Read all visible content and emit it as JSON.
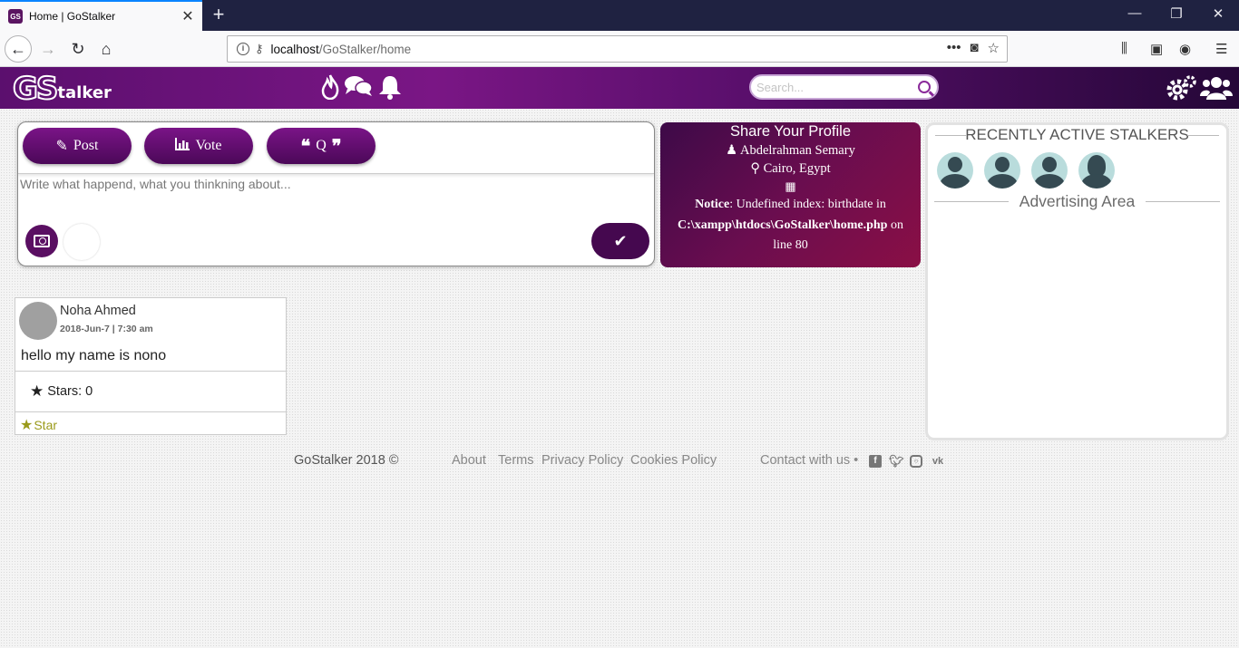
{
  "browser": {
    "tab_title": "Home | GoStalker",
    "favicon_text": "GS",
    "url_host": "localhost",
    "url_path": "/GoStalker/home"
  },
  "header": {
    "logo_gs": "GS",
    "logo_rest": "talker",
    "search_placeholder": "Search..."
  },
  "composer": {
    "buttons": [
      {
        "label": "Post",
        "icon": "edit-icon"
      },
      {
        "label": "Vote",
        "icon": "chart-icon"
      },
      {
        "label": "Q",
        "icon": "quote-icon"
      }
    ],
    "placeholder": "Write what happend, what you thinkning about..."
  },
  "profile_card": {
    "title": "Share Your Profile",
    "name": "Abdelrahman Semary",
    "location": "Cairo, Egypt",
    "notice_label": "Notice",
    "notice_text": ": Undefined index: birthdate in",
    "notice_path": "C:\\xampp\\htdocs\\GoStalker\\home.php",
    "notice_on": " on",
    "notice_line": "line 80"
  },
  "sidebar": {
    "heading": "RECENTLY ACTIVE STALKERS",
    "ad_heading": "Advertising Area"
  },
  "post": {
    "author": "Noha Ahmed",
    "date": "2018-Jun-7 | 7:30 am",
    "body": "hello my name is nono",
    "stars": "Stars: 0",
    "star_button": "Star"
  },
  "footer": {
    "copyright": "GoStalker 2018 ©",
    "links": [
      "About",
      "Terms",
      "Privacy Policy",
      "Cookies Policy"
    ],
    "contact": "Contact with us •"
  },
  "colors": {
    "brand_purple": "#5b0f6e",
    "brand_dark": "#45084f",
    "notice_gradient_end": "#8a0f45"
  }
}
